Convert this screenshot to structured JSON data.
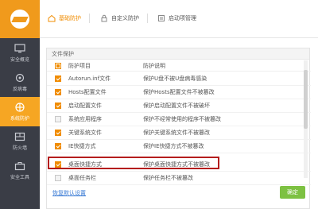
{
  "sidebar": {
    "items": [
      {
        "label": "安全概览",
        "icon": "monitor-icon"
      },
      {
        "label": "反病毒",
        "icon": "shield-virus-icon"
      },
      {
        "label": "系统防护",
        "icon": "crosshair-icon",
        "active": true
      },
      {
        "label": "防火墙",
        "icon": "firewall-icon"
      },
      {
        "label": "安全工具",
        "icon": "toolbox-icon"
      }
    ]
  },
  "tabs": [
    {
      "label": "基础防护",
      "icon": "home-icon",
      "active": true
    },
    {
      "label": "自定义防护",
      "icon": "lock-icon"
    },
    {
      "label": "启动项管理",
      "icon": "list-icon"
    }
  ],
  "panel": {
    "title": "文件保护",
    "headers": {
      "item": "防护项目",
      "desc": "防护说明"
    },
    "rows": [
      {
        "name": "Autorun.inf文件",
        "desc": "保护U盘不被U盘病毒感染",
        "state": "checked"
      },
      {
        "name": "Hosts配置文件",
        "desc": "保护Hosts配置文件不被篡改",
        "state": "checked"
      },
      {
        "name": "启动配置文件",
        "desc": "保护启动配置文件不被破坏",
        "state": "checked"
      },
      {
        "name": "系统应用程序",
        "desc": "保护不经常使用的程序不被篡改",
        "state": "unchecked"
      },
      {
        "name": "关键系统文件",
        "desc": "保护关键系统文件不被篡改",
        "state": "checked"
      },
      {
        "name": "IE快捷方式",
        "desc": "保护IE快捷方式不被篡改",
        "state": "checked"
      },
      {
        "name": "桌面快捷方式",
        "desc": "保护桌面快捷方式不被篡改",
        "state": "checked"
      },
      {
        "name": "桌面任务栏",
        "desc": "保护任务栏不被篡改",
        "state": "unchecked"
      }
    ]
  },
  "footer": {
    "restore_label": "恢复默认设置",
    "confirm_label": "确定"
  },
  "colors": {
    "accent": "#f08c00",
    "sidebar": "#3a3d46",
    "active_nav": "#f6a623",
    "highlight": "#b41d1d",
    "confirm": "#7dc142"
  }
}
